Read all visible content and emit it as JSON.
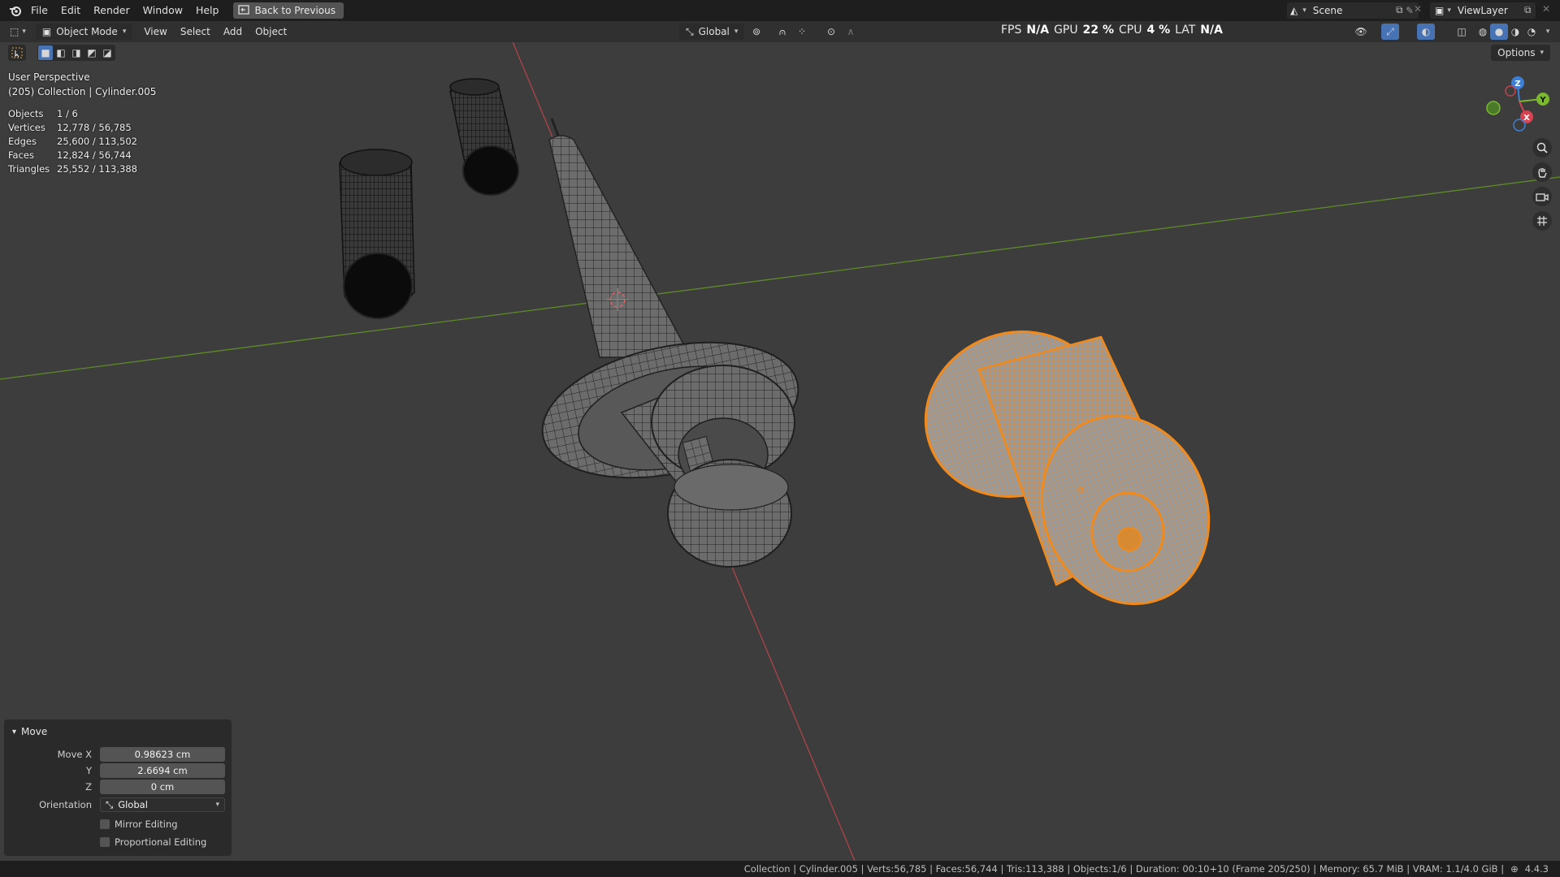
{
  "topbar": {
    "menus": [
      "File",
      "Edit",
      "Render",
      "Window",
      "Help"
    ],
    "back_label": "Back to Previous",
    "scene": "Scene",
    "view_layer": "ViewLayer"
  },
  "header": {
    "mode": "Object Mode",
    "menus": [
      "View",
      "Select",
      "Add",
      "Object"
    ],
    "orientation": "Global"
  },
  "perf": {
    "fps_label": "FPS",
    "fps_value": "N/A",
    "gpu_label": "GPU",
    "gpu_value": "22 %",
    "cpu_label": "CPU",
    "cpu_value": "4 %",
    "lat_label": "LAT",
    "lat_value": "N/A"
  },
  "options_label": "Options",
  "viewport": {
    "perspective": "User Perspective",
    "context": "(205) Collection | Cylinder.005"
  },
  "stats": [
    {
      "label": "Objects",
      "value": "1 / 6"
    },
    {
      "label": "Vertices",
      "value": "12,778 / 56,785"
    },
    {
      "label": "Edges",
      "value": "25,600 / 113,502"
    },
    {
      "label": "Faces",
      "value": "12,824 / 56,744"
    },
    {
      "label": "Triangles",
      "value": "25,552 / 113,388"
    }
  ],
  "operator": {
    "title": "Move",
    "move_x_label": "Move X",
    "move_x": "0.98623 cm",
    "y_label": "Y",
    "y": "2.6694 cm",
    "z_label": "Z",
    "z": "0 cm",
    "orientation_label": "Orientation",
    "orientation": "Global",
    "mirror_label": "Mirror Editing",
    "proportional_label": "Proportional Editing"
  },
  "gizmo": {
    "x": "X",
    "y": "Y",
    "z": "Z"
  },
  "status": {
    "text": "Collection | Cylinder.005 | Verts:56,785 | Faces:56,744 | Tris:113,388 | Objects:1/6 | Duration: 00:10+10 (Frame 205/250) | Memory: 65.7 MiB | VRAM: 1.1/4.0 GiB |",
    "version": "4.4.3"
  },
  "colors": {
    "selection": "#f08a1c",
    "x_axis": "#c8424a",
    "y_axis": "#6a9a2c",
    "accent": "#4772b3"
  }
}
